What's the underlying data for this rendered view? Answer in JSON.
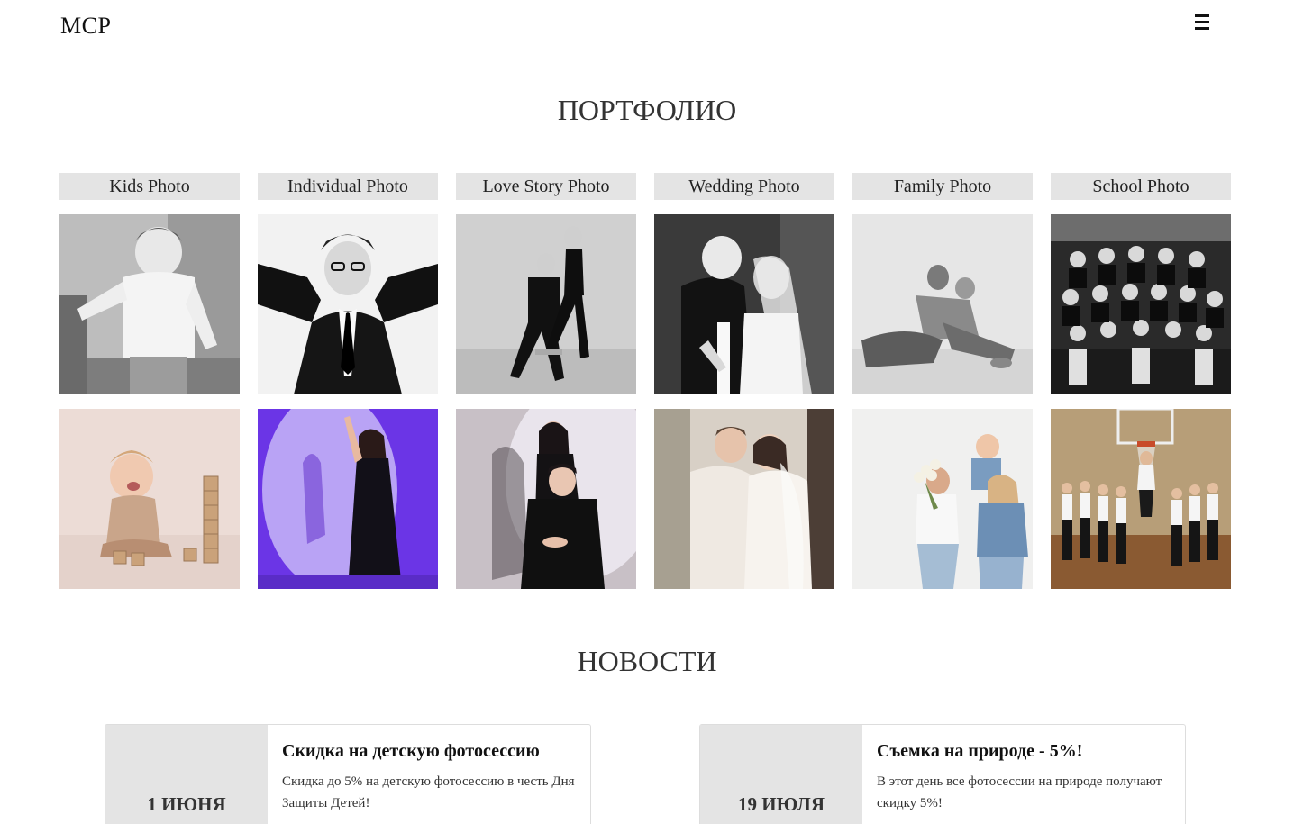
{
  "header": {
    "logo": "MCP",
    "menu_icon": "hamburger-menu-icon"
  },
  "portfolio": {
    "title": "ПОРТФОЛИО",
    "categories": [
      {
        "label": "Kids Photo"
      },
      {
        "label": "Individual Photo"
      },
      {
        "label": "Love Story Photo"
      },
      {
        "label": "Wedding Photo"
      },
      {
        "label": "Family Photo"
      },
      {
        "label": "School Photo"
      }
    ],
    "photos": [
      {
        "name": "kids-photo-bw",
        "category": "Kids Photo"
      },
      {
        "name": "individual-photo-bw",
        "category": "Individual Photo"
      },
      {
        "name": "love-story-photo-bw",
        "category": "Love Story Photo"
      },
      {
        "name": "wedding-photo-bw",
        "category": "Wedding Photo"
      },
      {
        "name": "family-photo-bw",
        "category": "Family Photo"
      },
      {
        "name": "school-photo-bw",
        "category": "School Photo"
      },
      {
        "name": "kids-photo-color",
        "category": "Kids Photo"
      },
      {
        "name": "individual-photo-color",
        "category": "Individual Photo"
      },
      {
        "name": "love-story-photo-color",
        "category": "Love Story Photo"
      },
      {
        "name": "wedding-photo-color",
        "category": "Wedding Photo"
      },
      {
        "name": "family-photo-color",
        "category": "Family Photo"
      },
      {
        "name": "school-photo-color",
        "category": "School Photo"
      }
    ]
  },
  "news": {
    "title": "НОВОСТИ",
    "items": [
      {
        "date": "1 ИЮНЯ",
        "title": "Скидка на детскую фотосессию",
        "text": "Скидка до 5% на детскую фотосессию в честь Дня Защиты Детей!"
      },
      {
        "date": "19 ИЮЛЯ",
        "title": "Съемка на природе - 5%!",
        "text": "В этот день все фотосессии на природе получают скидку 5%!"
      }
    ]
  },
  "colors": {
    "category_bg": "#e4e4e4",
    "date_bg": "#e4e4e4",
    "text": "#222222"
  }
}
